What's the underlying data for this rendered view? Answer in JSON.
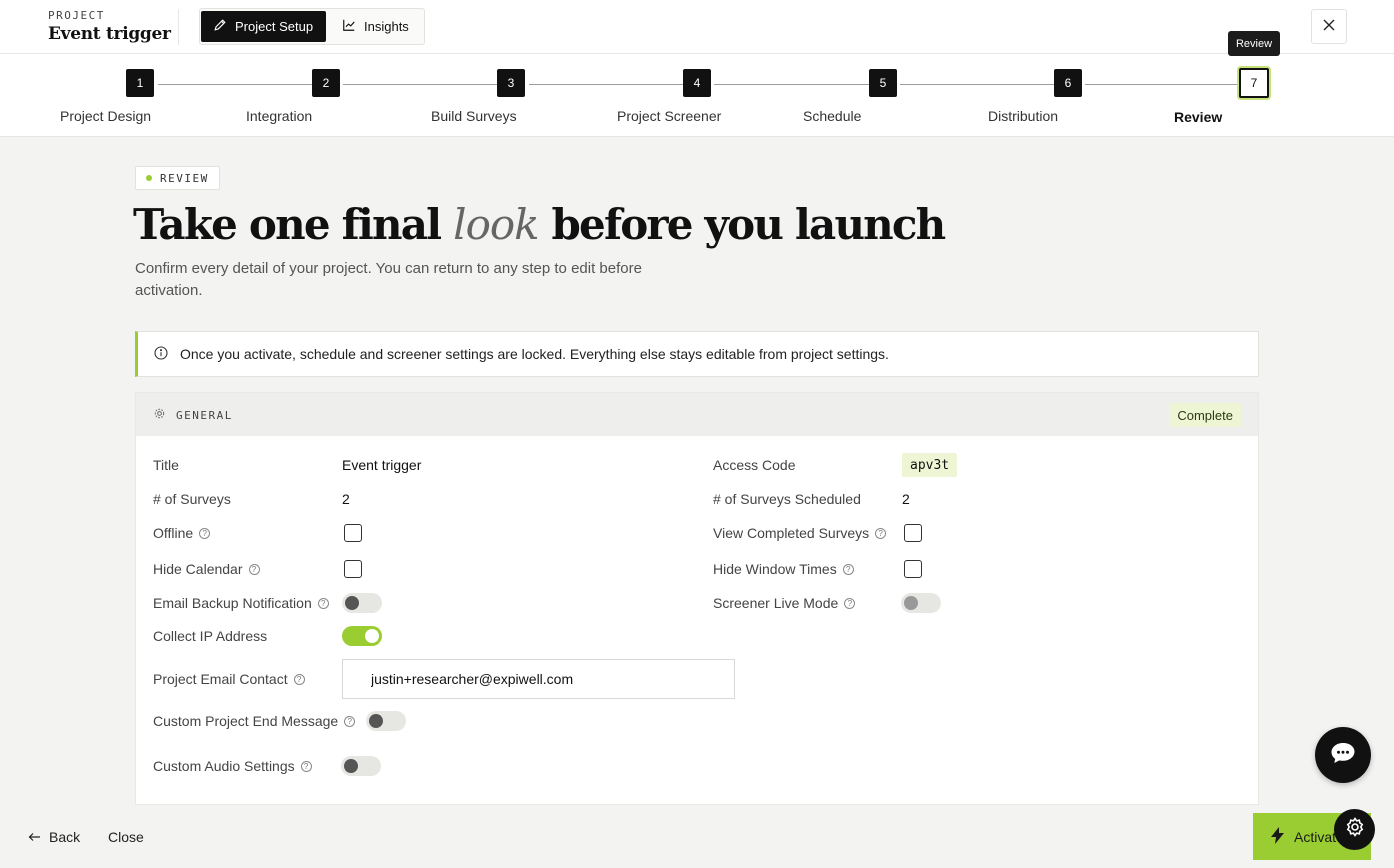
{
  "header": {
    "eyebrow": "PROJECT",
    "project_name": "Event trigger",
    "tabs": [
      {
        "label": "Project Setup",
        "icon": "pencil-icon",
        "active": true
      },
      {
        "label": "Insights",
        "icon": "chart-line-icon",
        "active": false
      }
    ],
    "tooltip": "Review"
  },
  "stepper": {
    "steps": [
      {
        "num": "1",
        "label": "Project Design"
      },
      {
        "num": "2",
        "label": "Integration"
      },
      {
        "num": "3",
        "label": "Build Surveys"
      },
      {
        "num": "4",
        "label": "Project Screener"
      },
      {
        "num": "5",
        "label": "Schedule"
      },
      {
        "num": "6",
        "label": "Distribution"
      },
      {
        "num": "7",
        "label": "Review"
      }
    ],
    "current": 7
  },
  "main": {
    "pill": "REVIEW",
    "title_before": "Take one final",
    "title_em": "look",
    "title_after": "before you launch",
    "subtitle": "Confirm every detail of your project. You can return to any step to edit before activation.",
    "notice": "Once you activate, schedule and screener settings are locked. Everything else stays editable from project settings."
  },
  "general": {
    "section_title": "GENERAL",
    "status": "Complete",
    "fields": {
      "title_label": "Title",
      "title_value": "Event trigger",
      "surveys_label": "# of Surveys",
      "surveys_value": "2",
      "offline_label": "Offline",
      "hide_calendar_label": "Hide Calendar",
      "email_backup_label": "Email Backup Notification",
      "collect_ip_label": "Collect IP Address",
      "email_contact_label": "Project Email Contact",
      "email_contact_value": "justin+researcher@expiwell.com",
      "custom_end_label": "Custom Project End Message",
      "custom_audio_label": "Custom Audio Settings",
      "access_code_label": "Access Code",
      "access_code_value": "apv3t",
      "scheduled_label": "# of Surveys Scheduled",
      "scheduled_value": "2",
      "view_completed_label": "View Completed Surveys",
      "hide_window_label": "Hide Window Times",
      "screener_live_label": "Screener Live Mode"
    },
    "states": {
      "offline": false,
      "hide_calendar": false,
      "email_backup": false,
      "collect_ip": true,
      "custom_end": false,
      "custom_audio": false,
      "view_completed": false,
      "hide_window": false,
      "screener_live": false
    }
  },
  "footer": {
    "back": "Back",
    "close": "Close",
    "activate": "Activate"
  },
  "colors": {
    "accent": "#9acd32",
    "accent_soft": "#eef5d5",
    "dark": "#111111",
    "page_bg": "#f3f3f1"
  }
}
